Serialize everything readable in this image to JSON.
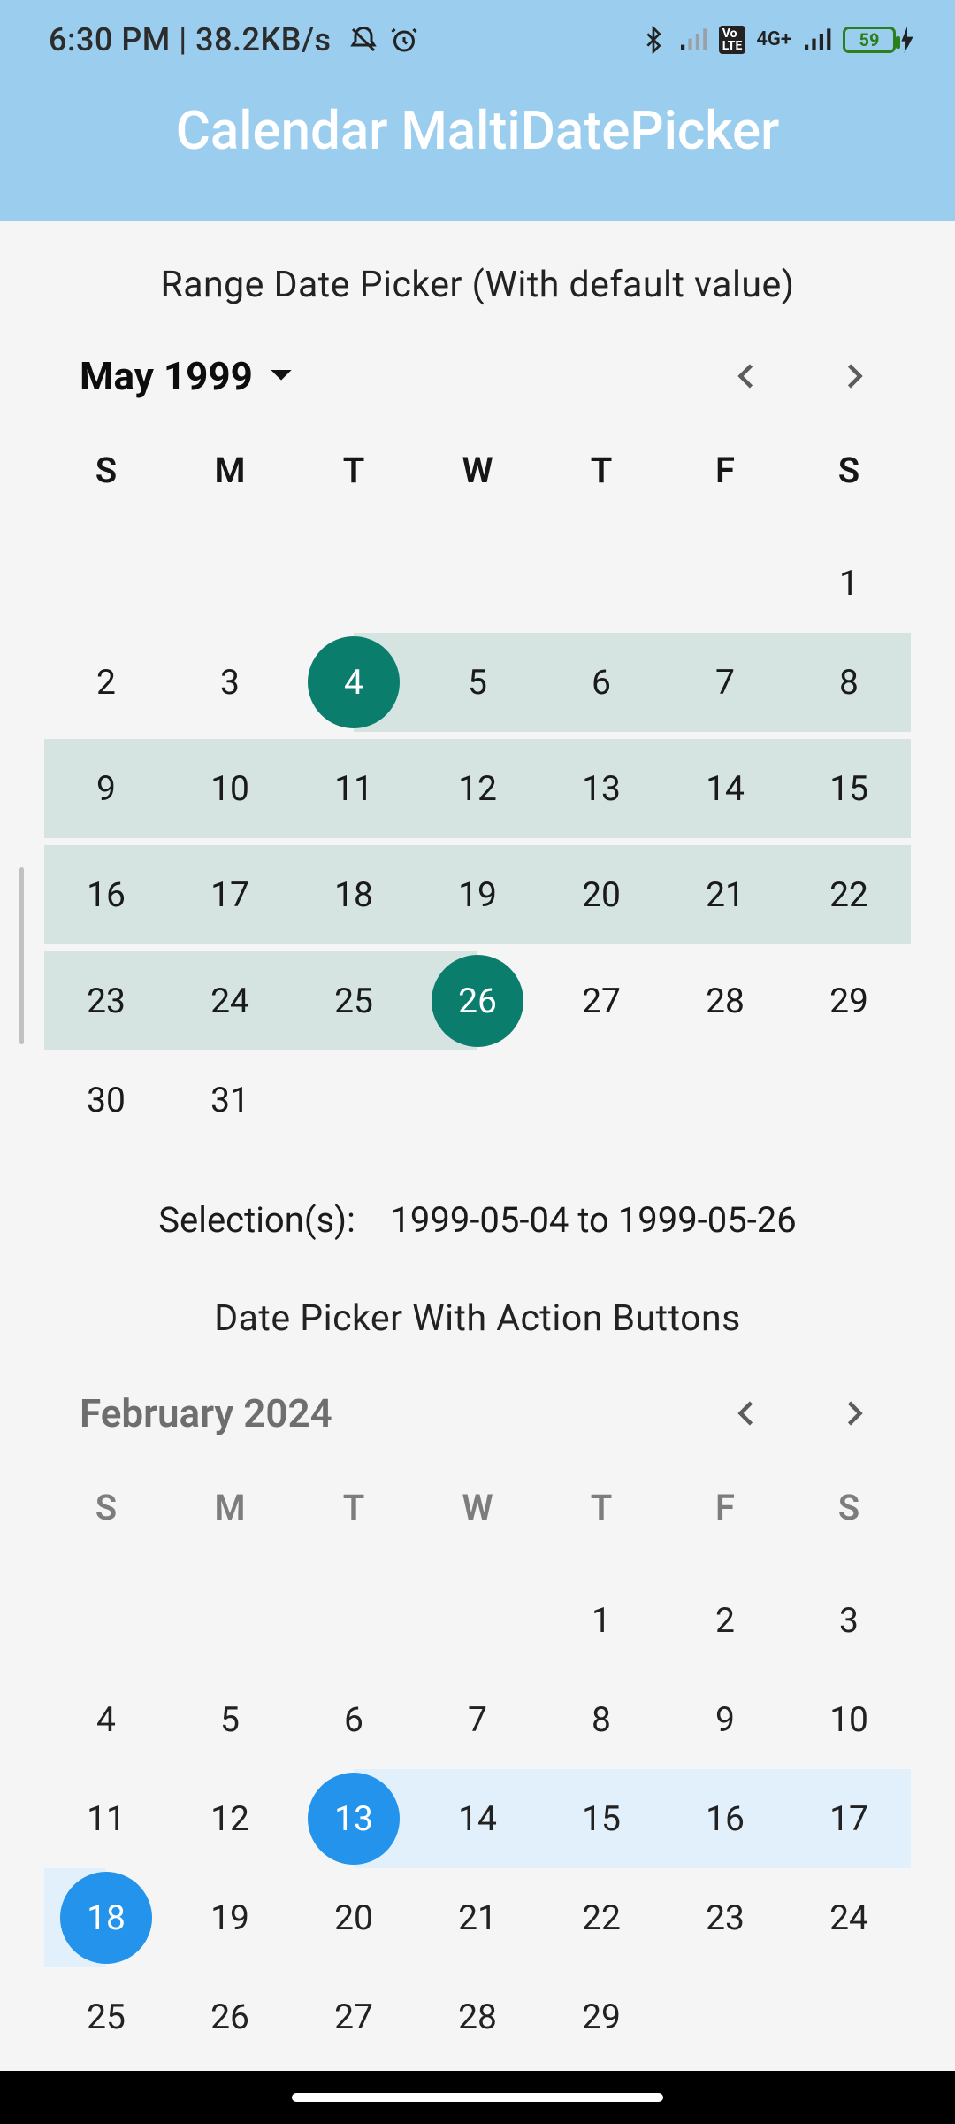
{
  "status": {
    "time": "6:30 PM",
    "sep": " | ",
    "speed": "38.2KB/s",
    "icons_left": [
      "dnd-icon",
      "alarm-icon"
    ],
    "icons_right": [
      "bluetooth-icon",
      "signal-weak-icon",
      "volte-icon",
      "network-4gplus-icon",
      "signal-icon"
    ],
    "battery": "59",
    "charging": true
  },
  "app": {
    "title": "Calendar MaltiDatePicker"
  },
  "section1": {
    "title": "Range Date Picker (With default value)",
    "month": "May 1999",
    "dow": [
      "S",
      "M",
      "T",
      "W",
      "T",
      "F",
      "S"
    ],
    "weeks": [
      [
        "",
        "",
        "",
        "",
        "",
        "",
        "1"
      ],
      [
        "2",
        "3",
        "4",
        "5",
        "6",
        "7",
        "8"
      ],
      [
        "9",
        "10",
        "11",
        "12",
        "13",
        "14",
        "15"
      ],
      [
        "16",
        "17",
        "18",
        "19",
        "20",
        "21",
        "22"
      ],
      [
        "23",
        "24",
        "25",
        "26",
        "27",
        "28",
        "29"
      ],
      [
        "30",
        "31",
        "",
        "",
        "",
        "",
        ""
      ]
    ],
    "range_start": "4",
    "range_end": "26",
    "summary_label": "Selection(s):",
    "summary_value": "1999-05-04  to 1999-05-26"
  },
  "section2": {
    "title": "Date Picker With Action Buttons",
    "month": "February 2024",
    "dow": [
      "S",
      "M",
      "T",
      "W",
      "T",
      "F",
      "S"
    ],
    "weeks": [
      [
        "",
        "",
        "",
        "",
        "1",
        "2",
        "3"
      ],
      [
        "4",
        "5",
        "6",
        "7",
        "8",
        "9",
        "10"
      ],
      [
        "11",
        "12",
        "13",
        "14",
        "15",
        "16",
        "17"
      ],
      [
        "18",
        "19",
        "20",
        "21",
        "22",
        "23",
        "24"
      ],
      [
        "25",
        "26",
        "27",
        "28",
        "29",
        "",
        ""
      ]
    ],
    "range_start": "13",
    "range_end": "18"
  }
}
